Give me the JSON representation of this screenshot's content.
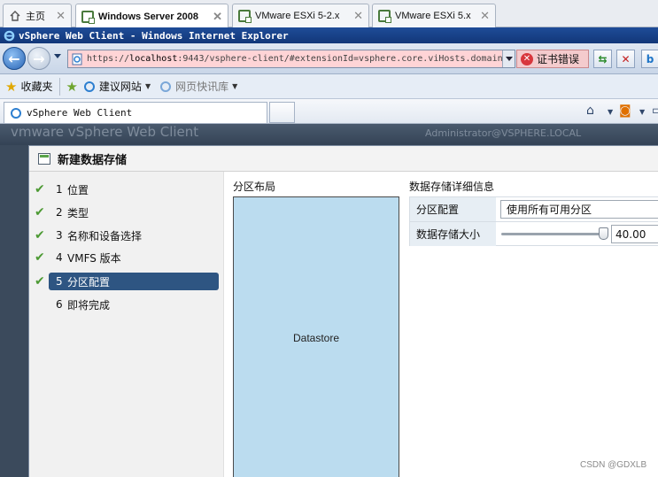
{
  "host_tabs": [
    {
      "label": "主页"
    },
    {
      "label": "Windows Server 2008"
    },
    {
      "label": "VMware ESXi 5-2.x"
    },
    {
      "label": "VMware ESXi 5.x"
    }
  ],
  "window_title": "vSphere Web Client - Windows Internet Explorer",
  "address": {
    "prefix": "https://",
    "host": "localhost",
    "rest": ":9443/vsphere-client/#extensionId=vsphere.core.viHosts.domain"
  },
  "cert_error": "证书错误",
  "favorites": {
    "favorites_label": "收藏夹",
    "suggested_sites": "建议网站",
    "web_slice": "网页快讯库"
  },
  "page_tab": "vSphere Web Client",
  "vsphere_header": {
    "brand": "vmware vSphere Web Client",
    "user": "Administrator@VSPHERE.LOCAL"
  },
  "dialog": {
    "title": "新建数据存储",
    "steps": [
      {
        "num": "1",
        "label": "位置",
        "done": true
      },
      {
        "num": "2",
        "label": "类型",
        "done": true
      },
      {
        "num": "3",
        "label": "名称和设备选择",
        "done": true
      },
      {
        "num": "4",
        "label": "VMFS 版本",
        "done": true
      },
      {
        "num": "5",
        "label": "分区配置",
        "done": true,
        "active": true
      },
      {
        "num": "6",
        "label": "即将完成",
        "done": false
      }
    ],
    "layout_title": "分区布局",
    "layout_block": "Datastore",
    "details_title": "数据存储详细信息",
    "partition_config_label": "分区配置",
    "partition_config_value": "使用所有可用分区",
    "size_label": "数据存储大小",
    "size_value": "40.00",
    "size_slider_fraction": 1.0
  },
  "watermark": "CSDN @GDXLB"
}
